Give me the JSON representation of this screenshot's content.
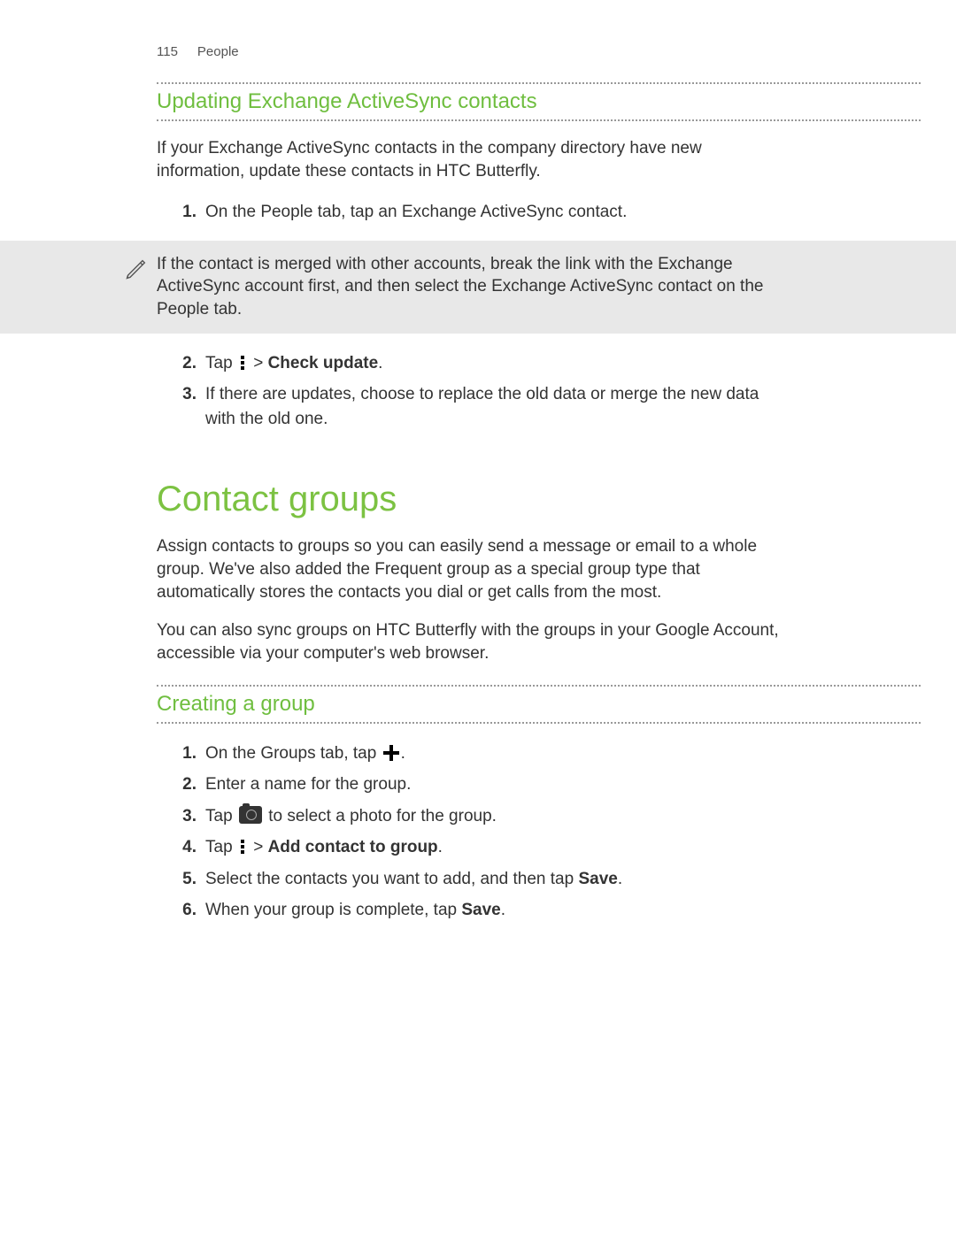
{
  "header": {
    "page_number": "115",
    "section": "People"
  },
  "section1": {
    "title": "Updating Exchange ActiveSync contacts",
    "intro": "If your Exchange ActiveSync contacts in the company directory have new information, update these contacts in HTC Butterfly.",
    "step1": "On the People tab, tap an Exchange ActiveSync contact.",
    "note": "If the contact is merged with other accounts, break the link with the Exchange ActiveSync account first, and then select the Exchange ActiveSync contact on the People tab.",
    "step2_pre": "Tap ",
    "step2_gt": " > ",
    "step2_bold": "Check update",
    "step2_end": ".",
    "step3": "If there are updates, choose to replace the old data or merge the new data with the old one."
  },
  "section2": {
    "title": "Contact groups",
    "p1": "Assign contacts to groups so you can easily send a message or email to a whole group. We've also added the Frequent group as a special group type that automatically stores the contacts you dial or get calls from the most.",
    "p2": "You can also sync groups on HTC Butterfly with the groups in your Google Account, accessible via your computer's web browser."
  },
  "section3": {
    "title": "Creating a group",
    "step1_pre": "On the Groups tab, tap ",
    "step1_end": ".",
    "step2": "Enter a name for the group.",
    "step3_pre": "Tap ",
    "step3_post": " to select a photo for the group.",
    "step4_pre": "Tap ",
    "step4_gt": " > ",
    "step4_bold": "Add contact to group",
    "step4_end": ".",
    "step5_pre": "Select the contacts you want to add, and then tap ",
    "step5_bold": "Save",
    "step5_end": ".",
    "step6_pre": "When your group is complete, tap ",
    "step6_bold": "Save",
    "step6_end": "."
  },
  "nums": {
    "n1": "1.",
    "n2": "2.",
    "n3": "3.",
    "n4": "4.",
    "n5": "5.",
    "n6": "6."
  }
}
